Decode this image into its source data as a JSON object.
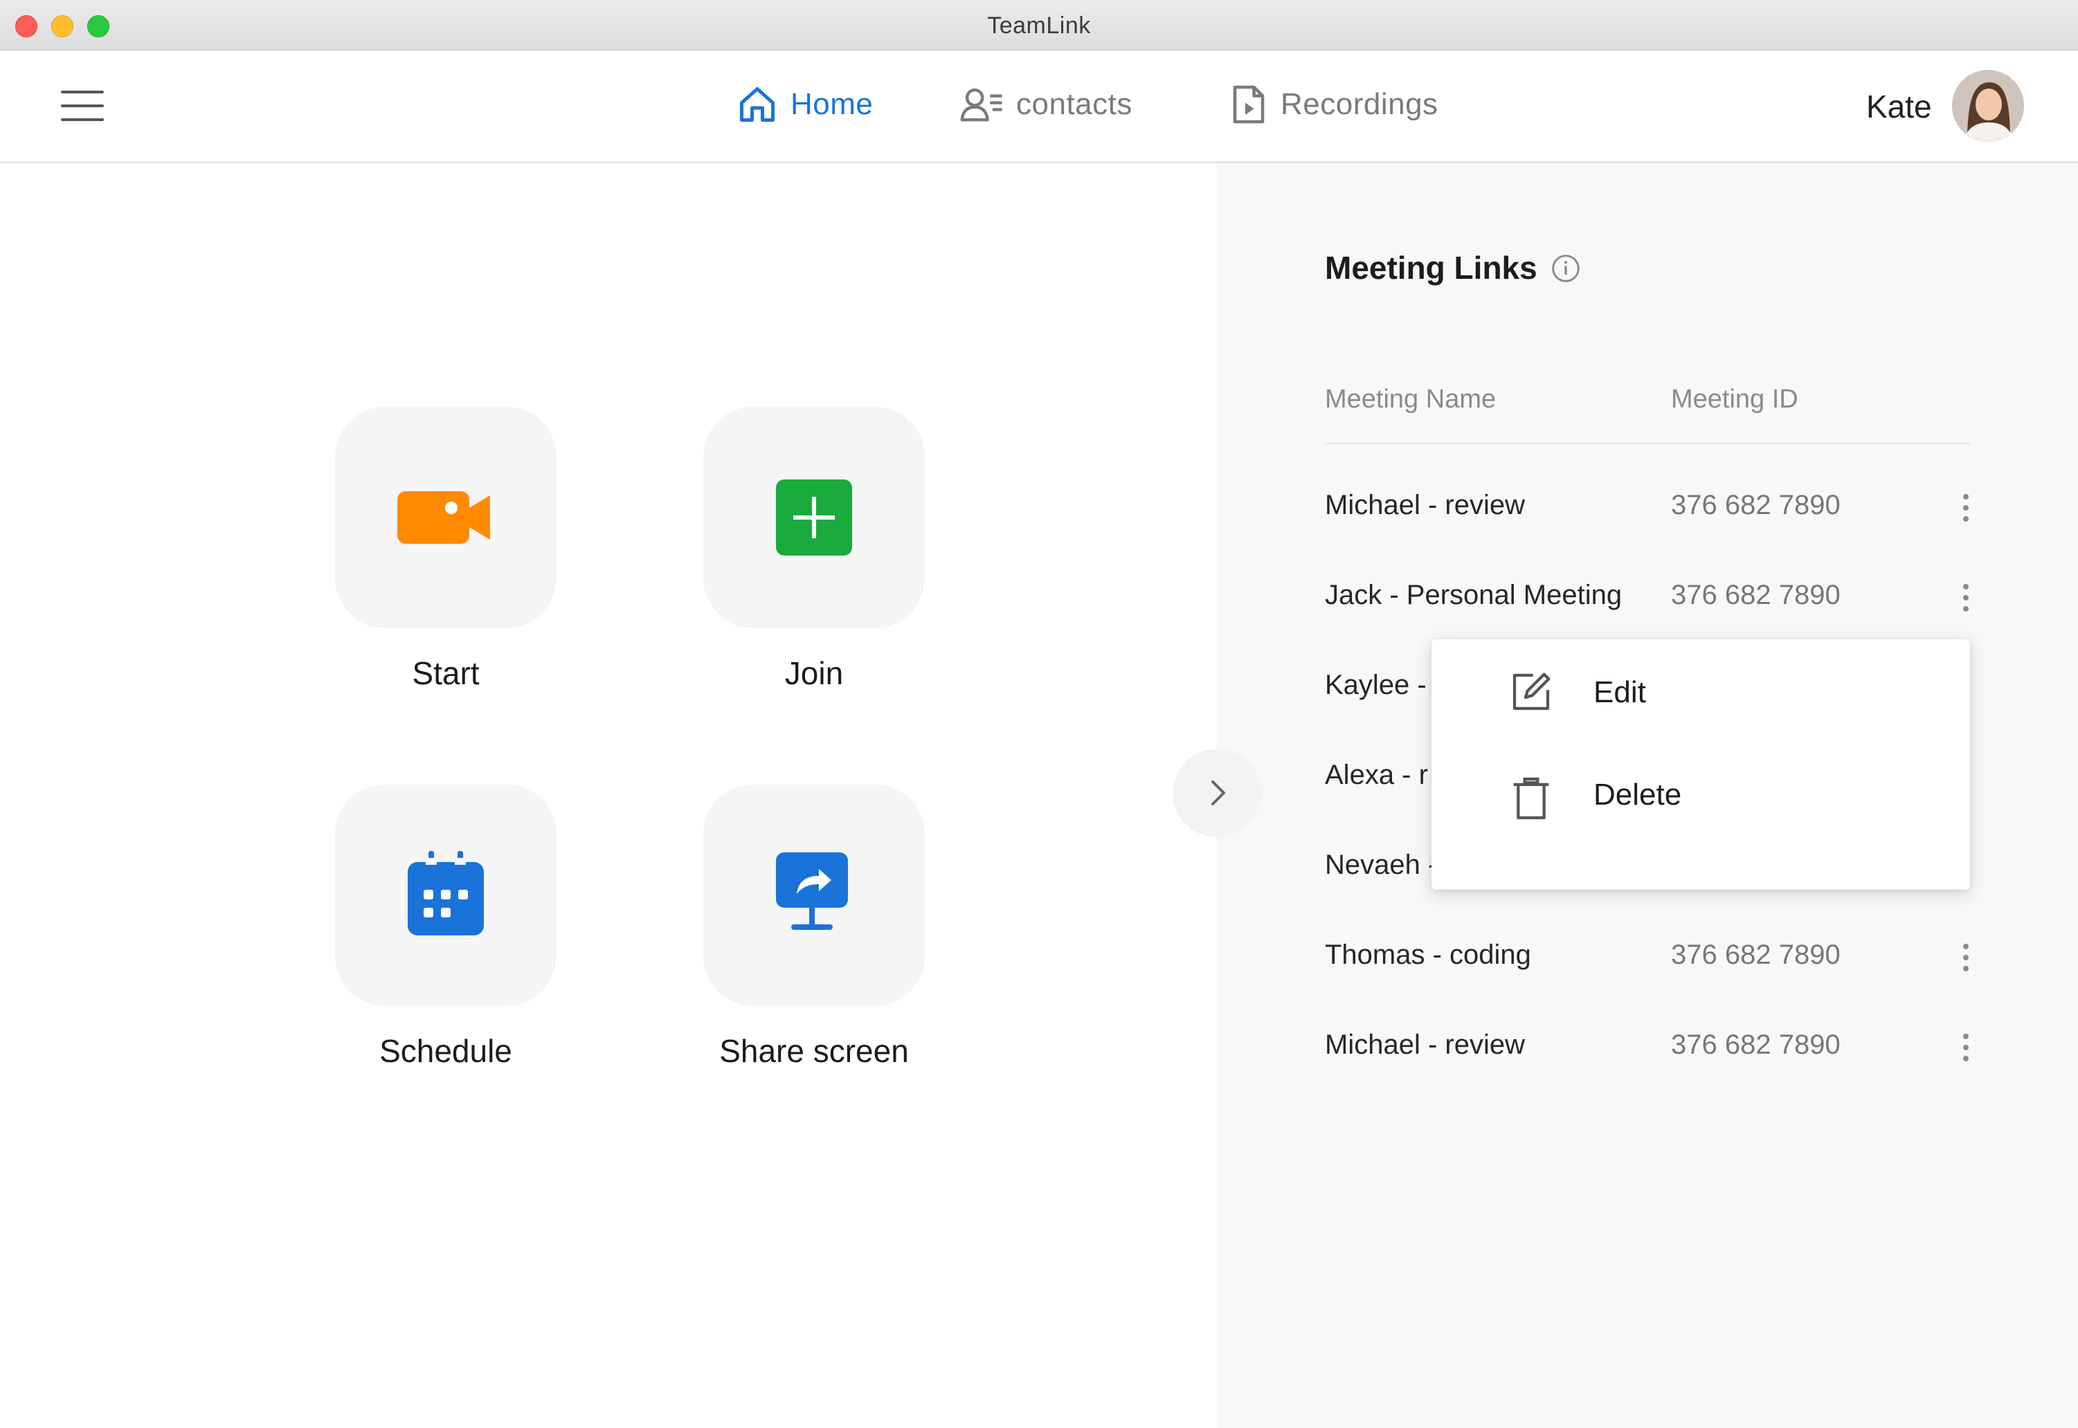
{
  "window": {
    "title": "TeamLink"
  },
  "nav": {
    "items": [
      {
        "label": "Home",
        "icon": "home-icon",
        "active": true
      },
      {
        "label": "contacts",
        "icon": "contacts-icon",
        "active": false
      },
      {
        "label": "Recordings",
        "icon": "recording-file-icon",
        "active": false
      }
    ],
    "user": {
      "name": "Kate"
    }
  },
  "actions": {
    "start": {
      "label": "Start",
      "icon": "video-camera-icon",
      "color": "#ff8a00"
    },
    "join": {
      "label": "Join",
      "icon": "plus-icon",
      "color": "#1aab3c"
    },
    "schedule": {
      "label": "Schedule",
      "icon": "calendar-icon",
      "color": "#1a73d8"
    },
    "share": {
      "label": "Share screen",
      "icon": "share-screen-icon",
      "color": "#1a73d8"
    }
  },
  "meeting_links": {
    "title": "Meeting Links",
    "columns": {
      "name": "Meeting Name",
      "id": "Meeting ID"
    },
    "rows": [
      {
        "name": "Michael - review",
        "id": "376 682 7890"
      },
      {
        "name": "Jack - Personal Meeting",
        "id": "376 682 7890"
      },
      {
        "name": "Kaylee -",
        "id": ""
      },
      {
        "name": "Alexa - r",
        "id": ""
      },
      {
        "name": "Nevaeh -",
        "id": ""
      },
      {
        "name": "Thomas - coding",
        "id": "376 682 7890"
      },
      {
        "name": "Michael - review",
        "id": "376 682 7890"
      }
    ]
  },
  "context_menu": {
    "edit": "Edit",
    "delete": "Delete"
  },
  "colors": {
    "accent": "#1c74d4",
    "muted_text": "#7a7a7a"
  }
}
